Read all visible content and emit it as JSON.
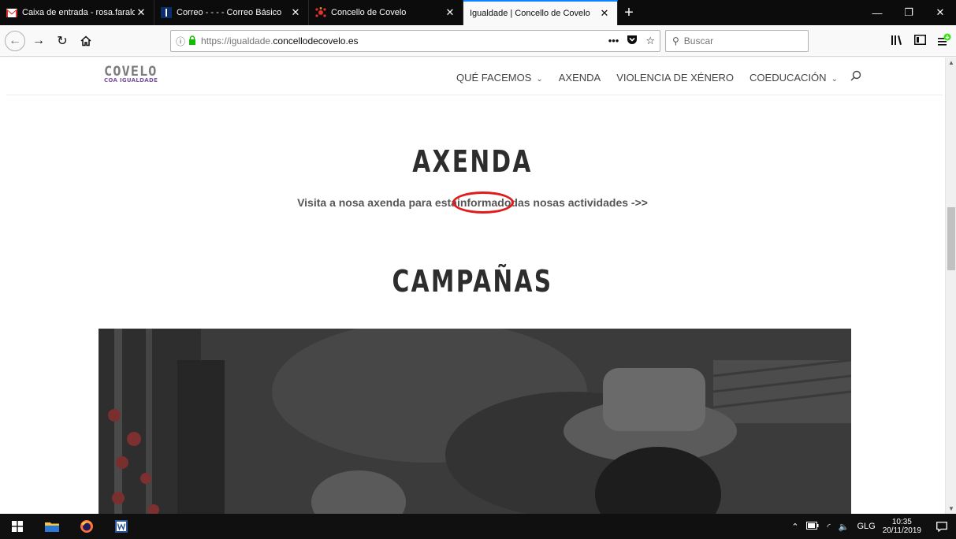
{
  "browser": {
    "tabs": [
      {
        "title": "Caixa de entrada - rosa.faraldo",
        "favicon": "gmail-icon",
        "active": false
      },
      {
        "title": "Correo - - - - Correo Básico",
        "favicon": "mail-icon",
        "active": false
      },
      {
        "title": "Concello de Covelo",
        "favicon": "covelo-icon",
        "active": false
      },
      {
        "title": "Igualdade | Concello de Covelo",
        "favicon": "",
        "active": true
      }
    ],
    "url_subdomain": "https://igualdade.",
    "url_domain": "concellodecovelo.es",
    "search_placeholder": "Buscar",
    "new_tab": "+",
    "close_glyph": "✕"
  },
  "site": {
    "logo_main": "COVELO",
    "logo_sub": "COA IGUALDADE",
    "menu": [
      {
        "label": "QUÉ FACEMOS",
        "dropdown": true
      },
      {
        "label": "AXENDA",
        "dropdown": false
      },
      {
        "label": "VIOLENCIA DE XÉNERO",
        "dropdown": false
      },
      {
        "label": "COEDUCACIÓN",
        "dropdown": true
      }
    ]
  },
  "main": {
    "axenda_heading": "AXENDA",
    "axenda_text_before": "Visita a nosa axenda para esta",
    "axenda_text_highlight": "informado",
    "axenda_text_after": "das nosas actividades  ->>",
    "campaigns_heading": "CAMPAÑAS"
  },
  "taskbar": {
    "language": "GLG",
    "time": "10:35",
    "date": "20/11/2019"
  },
  "colors": {
    "annotation_ring": "#e11b1b",
    "logo_sub": "#7a52a0",
    "active_tab_accent": "#0a84ff"
  }
}
